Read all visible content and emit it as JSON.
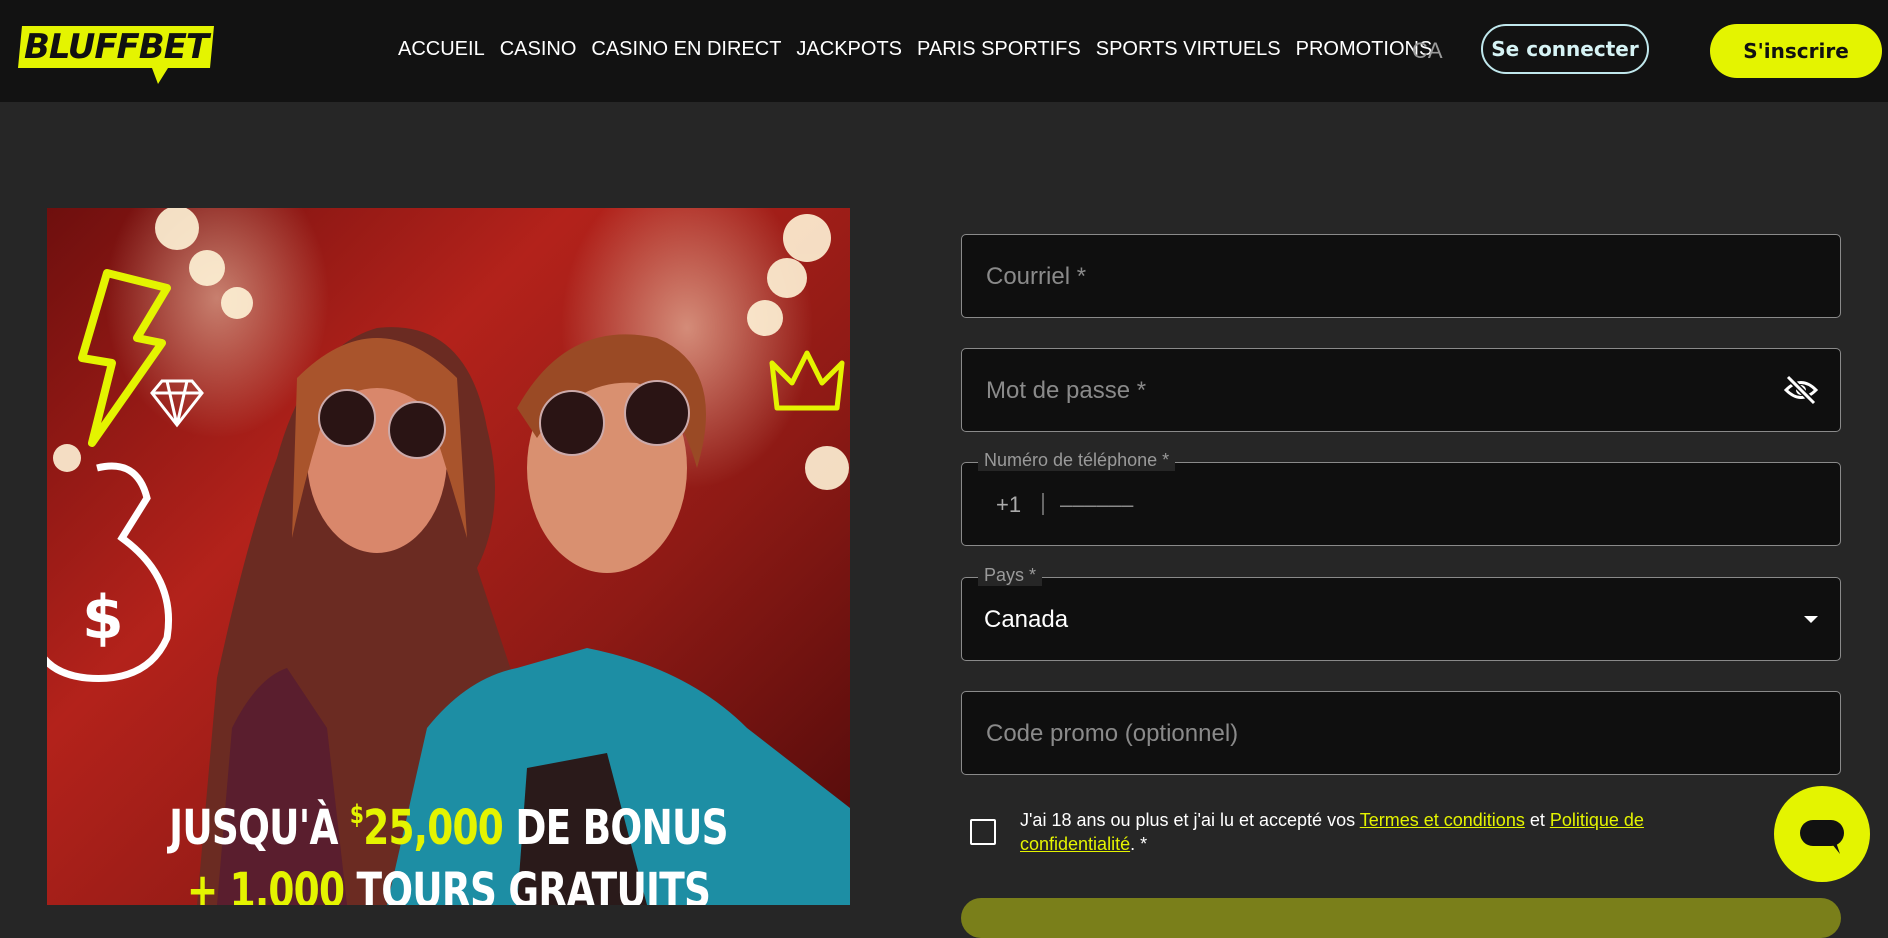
{
  "header": {
    "logo_text": "BLUFFBET",
    "nav": [
      "ACCUEIL",
      "CASINO",
      "CASINO EN DIRECT",
      "JACKPOTS",
      "PARIS SPORTIFS",
      "SPORTS VIRTUELS",
      "PROMOTIONS"
    ],
    "language": "CA",
    "login_label": "Se connecter",
    "signup_label": "S'inscrire"
  },
  "banner": {
    "line1_pre": "JUSQU'À",
    "line1_currency": "$",
    "line1_amount": "25,000",
    "line1_post": "DE BONUS",
    "line2_pre": "+",
    "line2_amount": "1,000",
    "line2_post": "TOURS GRATUITS"
  },
  "form": {
    "email_placeholder": "Courriel *",
    "password_placeholder": "Mot de passe *",
    "phone_label": "Numéro de téléphone *",
    "phone_prefix": "+1",
    "phone_placeholder": "––––––",
    "country_label": "Pays *",
    "country_value": "Canada",
    "promo_placeholder": "Code promo (optionnel)",
    "terms_text_1": "J'ai 18 ans ou plus et j'ai lu et accepté vos ",
    "terms_link_1": "Termes et conditions",
    "terms_text_2": " et ",
    "terms_link_2": "Politique de confidentialité",
    "terms_text_3": ". *"
  },
  "colors": {
    "accent": "#e4f400",
    "background": "#262626",
    "header": "#121212",
    "field": "#0f0f0f"
  },
  "icons": [
    "eye-off-icon",
    "chevron-down-icon",
    "chat-icon",
    "lightning-icon",
    "diamond-icon",
    "crown-icon"
  ]
}
